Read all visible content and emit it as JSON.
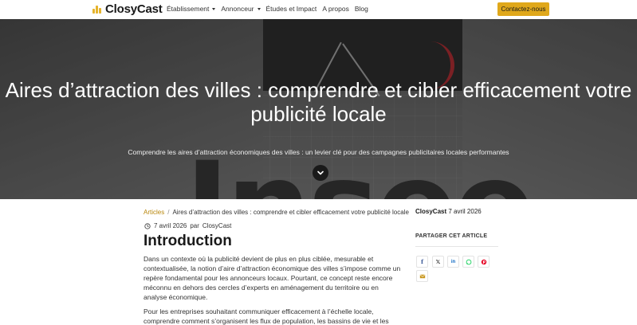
{
  "navbar": {
    "brand": "ClosyCast",
    "links": [
      {
        "label": "Établissement",
        "dropdown": true
      },
      {
        "label": "Annonceur",
        "dropdown": true
      },
      {
        "label": "Études et Impact",
        "dropdown": false
      },
      {
        "label": "A propos",
        "dropdown": false
      },
      {
        "label": "Blog",
        "dropdown": false
      }
    ],
    "cta_label": "Contactez-nous",
    "accent_color": "#e0a81b"
  },
  "hero": {
    "title": "Aires d’attraction des villes : comprendre et cibler efficacement votre publicité locale",
    "subtitle": "Comprendre les aires d’attraction économiques des villes : un levier clé pour des campagnes publicitaires locales performantes",
    "background_text": "Insee",
    "scroll_icon": "chevron-down-icon"
  },
  "breadcrumb": {
    "root": "Articles",
    "current": "Aires d’attraction des villes : comprendre et cibler efficacement votre publicité locale"
  },
  "meta": {
    "date": "7 avril 2026",
    "by": "par",
    "author": "ClosyCast"
  },
  "article": {
    "heading": "Introduction",
    "paragraphs": [
      "Dans un contexte où la publicité devient de plus en plus ciblée, mesurable et contextualisée, la notion d’aire d’attraction économique des villes s’impose comme un repère fondamental pour les annonceurs locaux. Pourtant, ce concept reste encore méconnu en dehors des cercles d’experts en aménagement du territoire ou en analyse économique.",
      "Pour les entreprises souhaitant communiquer efficacement à l’échelle locale, comprendre comment s’organisent les flux de population, les bassins de vie et les"
    ]
  },
  "sidebar": {
    "author": "ClosyCast",
    "date": "7 avril 2026",
    "share_title": "PARTAGER CET ARTICLE",
    "share_buttons": [
      {
        "name": "facebook",
        "glyph": "f",
        "color": "#3b5998"
      },
      {
        "name": "x",
        "glyph": "𝕏",
        "color": "#111111"
      },
      {
        "name": "linkedin",
        "glyph": "in",
        "color": "#0a66c2"
      },
      {
        "name": "whatsapp",
        "glyph": "",
        "color": "#25d366"
      },
      {
        "name": "pinterest",
        "glyph": "",
        "color": "#e60023"
      },
      {
        "name": "email",
        "glyph": "",
        "color": "#c8961e"
      }
    ]
  }
}
